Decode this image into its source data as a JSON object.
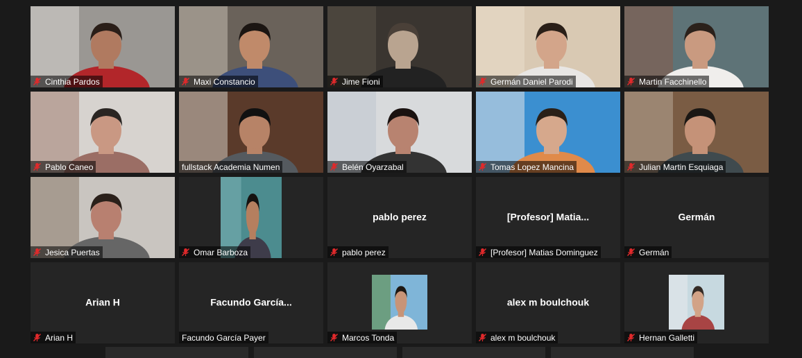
{
  "participants": [
    {
      "name": "Cinthia Pardos",
      "muted": true,
      "bg": "#9a9793",
      "bg2": "#d8d6d2",
      "skin": "#b07a60",
      "shirt": "#b2262a",
      "hair": "#2a1e18"
    },
    {
      "name": "Maxi Constancio",
      "muted": true,
      "bg": "#6a625a",
      "bg2": "#c2bbb0",
      "skin": "#c08a6a",
      "shirt": "#3d4f7a",
      "hair": "#1b1512"
    },
    {
      "name": "Jime Fioni",
      "muted": true,
      "bg": "#3a3530",
      "bg2": "#5a5248",
      "skin": "#b9a490",
      "shirt": "#222",
      "hair": "#4a4038"
    },
    {
      "name": "Germán Daniel Parodi",
      "muted": true,
      "bg": "#d9c9b3",
      "bg2": "#e9dccb",
      "skin": "#d3a58a",
      "shirt": "#e8e6e4",
      "hair": "#2a1f18"
    },
    {
      "name": "Martin Facchinello",
      "muted": true,
      "bg": "#5e7377",
      "bg2": "#8a5a48",
      "skin": "#c99a80",
      "shirt": "#f0eeec",
      "hair": "#2b211b"
    },
    {
      "name": "Pablo Caneo",
      "muted": true,
      "bg": "#d7d3cf",
      "bg2": "#a28072",
      "skin": "#c99883",
      "shirt": "#9b6e65",
      "hair": "#2a2522"
    },
    {
      "name": "fullstack Academia Numen",
      "muted": false,
      "active": true,
      "bg": "#5a3a2a",
      "bg2": "#cfc8c0",
      "skin": "#b78367",
      "shirt": "#555a5f",
      "hair": "#111"
    },
    {
      "name": "Belén Oyarzabal",
      "muted": true,
      "bg": "#d8dadc",
      "bg2": "#bfc6cf",
      "skin": "#b88370",
      "shirt": "#333",
      "hair": "#1a1210"
    },
    {
      "name": "Tomas Lopez Mancina",
      "muted": true,
      "bg": "#3b8fd0",
      "bg2": "#e2e4e6",
      "skin": "#d6a88c",
      "shirt": "#e08a4a",
      "hair": "#2a2018"
    },
    {
      "name": "Julian Martin Esquiaga",
      "muted": true,
      "bg": "#7a5c44",
      "bg2": "#b7a898",
      "skin": "#c59278",
      "shirt": "#3f4a4e",
      "hair": "#1b1714"
    },
    {
      "name": "Jesica Puertas",
      "muted": true,
      "bg": "#c9c5c0",
      "bg2": "#8a7a6a",
      "skin": "#b88070",
      "shirt": "#666",
      "hair": "#2a201a"
    },
    {
      "name": "Omar Barboza",
      "muted": true,
      "thumb": true,
      "bg": "#4c8c8f",
      "bg2": "#7bb1b5",
      "skin": "#b57f5f",
      "shirt": "#3e3c4a",
      "hair": "#151210"
    },
    {
      "name": "pablo perez",
      "muted": true,
      "display": "pablo perez"
    },
    {
      "name": "[Profesor] Matias Dominguez",
      "muted": true,
      "display": "[Profesor]  Matia..."
    },
    {
      "name": "Germán",
      "muted": true,
      "display": "Germán"
    },
    {
      "name": "Arian H",
      "muted": true,
      "display": "Arian H"
    },
    {
      "name": "Facundo García Payer",
      "muted": false,
      "display": "Facundo  García..."
    },
    {
      "name": "Marcos Tonda",
      "muted": true,
      "thumb": true,
      "bg": "#7fb5d8",
      "bg2": "#5d8a3a",
      "skin": "#c89477",
      "shirt": "#e8e8e8",
      "hair": "#1d1712"
    },
    {
      "name": "alex m boulchouk",
      "muted": true,
      "display": "alex m boulchouk"
    },
    {
      "name": "Hernan Galletti",
      "muted": true,
      "thumb": true,
      "bg": "#c7d9e0",
      "bg2": "#e8eaec",
      "skin": "#d2a387",
      "shirt": "#a84444",
      "hair": "#332a24"
    }
  ],
  "colors": {
    "muted": "#e0292b",
    "active_border": "#c9e56a"
  }
}
